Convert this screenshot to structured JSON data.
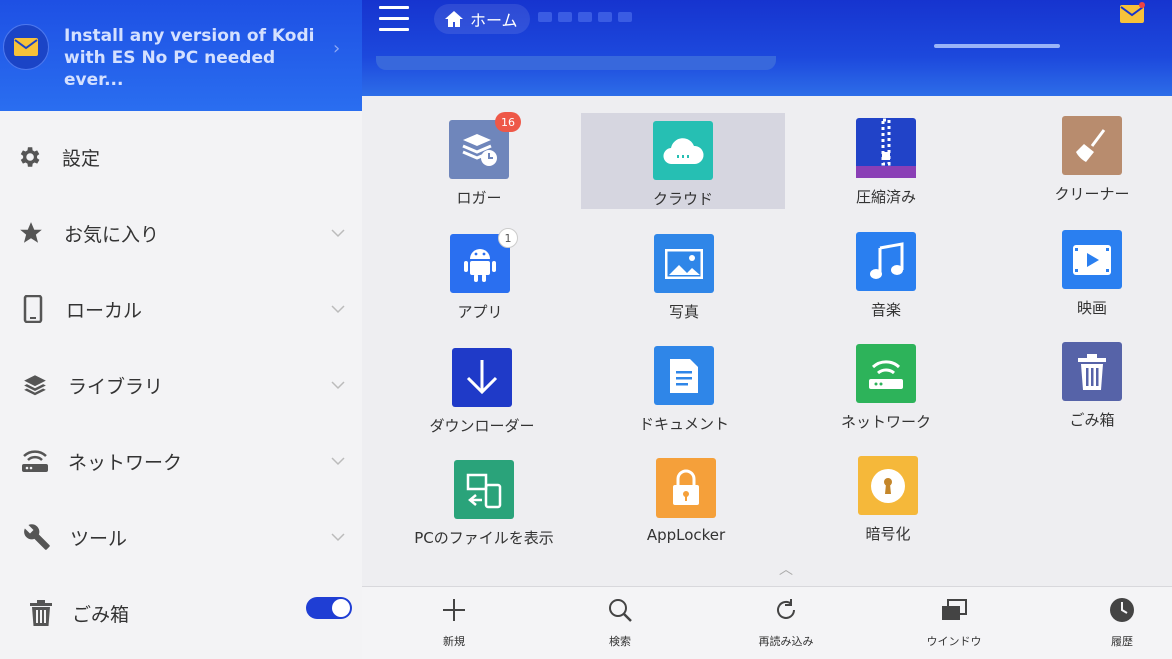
{
  "promo": {
    "text": "Install any version of Kodi with ES No PC needed ever..."
  },
  "drawer": {
    "items": [
      {
        "label": "設定"
      },
      {
        "label": "お気に入り"
      },
      {
        "label": "ローカル"
      },
      {
        "label": "ライブラリ"
      },
      {
        "label": "ネットワーク"
      },
      {
        "label": "ツール"
      },
      {
        "label": "ごみ箱"
      }
    ],
    "recycle_toggle": "on"
  },
  "header": {
    "breadcrumb_home": "ホーム"
  },
  "grid": {
    "tiles": [
      {
        "label": "ロガー",
        "icon": "logger-icon",
        "color": "#6f86bb",
        "badge": "16"
      },
      {
        "label": "クラウド",
        "icon": "cloud-icon",
        "color": "#26bfb3"
      },
      {
        "label": "圧縮済み",
        "icon": "zip-icon",
        "color": "#2143c8"
      },
      {
        "label": "クリーナー",
        "icon": "broom-icon",
        "color": "#b88c6e"
      },
      {
        "label": "アプリ",
        "icon": "android-icon",
        "color": "#2a6ff0",
        "badge": "1"
      },
      {
        "label": "写真",
        "icon": "photo-icon",
        "color": "#2f86e8"
      },
      {
        "label": "音楽",
        "icon": "music-icon",
        "color": "#2a7ff0"
      },
      {
        "label": "映画",
        "icon": "video-icon",
        "color": "#2a7ff0"
      },
      {
        "label": "ダウンローダー",
        "icon": "download-icon",
        "color": "#1f3ac8"
      },
      {
        "label": "ドキュメント",
        "icon": "document-icon",
        "color": "#2f86e8"
      },
      {
        "label": "ネットワーク",
        "icon": "router-icon",
        "color": "#2db35a"
      },
      {
        "label": "ごみ箱",
        "icon": "trash-icon",
        "color": "#5663a8"
      },
      {
        "label": "PCのファイルを表示",
        "icon": "pc-files-icon",
        "color": "#2aa37a"
      },
      {
        "label": "AppLocker",
        "icon": "lock-icon",
        "color": "#f5a03a"
      },
      {
        "label": "暗号化",
        "icon": "keyhole-icon",
        "color": "#f5b83a"
      }
    ]
  },
  "toolbar": {
    "new": "新規",
    "search": "検索",
    "reload": "再読み込み",
    "window": "ウインドウ",
    "history": "履歴"
  }
}
